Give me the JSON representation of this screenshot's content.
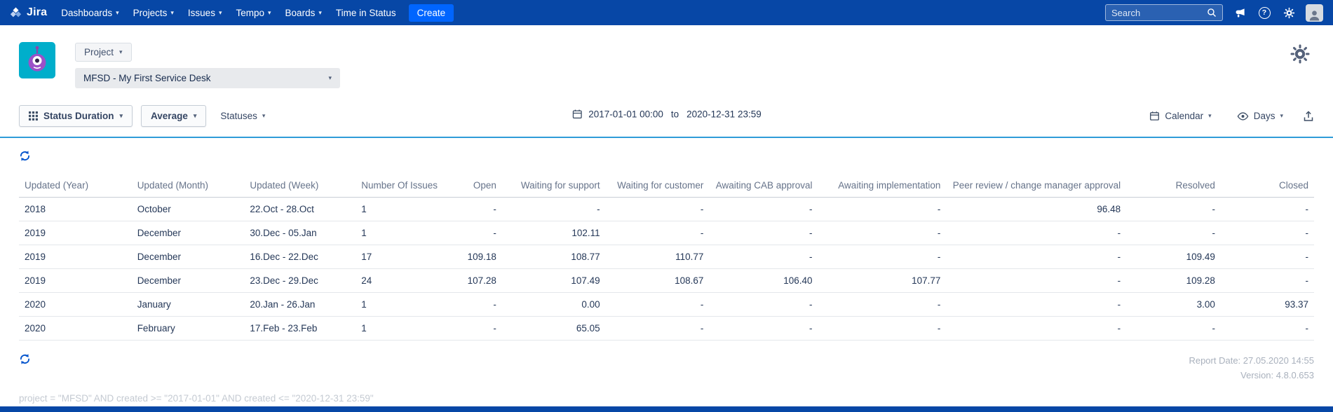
{
  "icons": {
    "chevron_down": "▾",
    "question_mark": "?"
  },
  "colors": {
    "header_blue": "#0747A6",
    "create_blue": "#0065FF",
    "accent_blue": "#0052CC",
    "divider_blue": "#2F9CD8"
  },
  "navbar": {
    "logo_text": "Jira",
    "items": [
      {
        "label": "Dashboards"
      },
      {
        "label": "Projects"
      },
      {
        "label": "Issues"
      },
      {
        "label": "Tempo"
      },
      {
        "label": "Boards"
      },
      {
        "label": "Time in Status"
      }
    ],
    "create_label": "Create",
    "search_placeholder": "Search"
  },
  "header": {
    "scope_label": "Project",
    "project": "MFSD - My First Service Desk"
  },
  "toolbar": {
    "report_type": "Status Duration",
    "aggregation": "Average",
    "statuses": "Statuses",
    "date_from": "2017-01-01 00:00",
    "date_separator": "to",
    "date_to": "2020-12-31 23:59",
    "calendar": "Calendar",
    "unit": "Days"
  },
  "table": {
    "columns": [
      "Updated (Year)",
      "Updated (Month)",
      "Updated (Week)",
      "Number Of Issues",
      "Open",
      "Waiting for support",
      "Waiting for customer",
      "Awaiting CAB approval",
      "Awaiting implementation",
      "Peer review / change manager approval",
      "Resolved",
      "Closed"
    ],
    "rows": [
      [
        "2018",
        "October",
        "22.Oct - 28.Oct",
        "1",
        "-",
        "-",
        "-",
        "-",
        "-",
        "96.48",
        "-",
        "-"
      ],
      [
        "2019",
        "December",
        "30.Dec - 05.Jan",
        "1",
        "-",
        "102.11",
        "-",
        "-",
        "-",
        "-",
        "-",
        "-"
      ],
      [
        "2019",
        "December",
        "16.Dec - 22.Dec",
        "17",
        "109.18",
        "108.77",
        "110.77",
        "-",
        "-",
        "-",
        "109.49",
        "-"
      ],
      [
        "2019",
        "December",
        "23.Dec - 29.Dec",
        "24",
        "107.28",
        "107.49",
        "108.67",
        "106.40",
        "107.77",
        "-",
        "109.28",
        "-"
      ],
      [
        "2020",
        "January",
        "20.Jan - 26.Jan",
        "1",
        "-",
        "0.00",
        "-",
        "-",
        "-",
        "-",
        "3.00",
        "93.37"
      ],
      [
        "2020",
        "February",
        "17.Feb - 23.Feb",
        "1",
        "-",
        "65.05",
        "-",
        "-",
        "-",
        "-",
        "-",
        "-"
      ]
    ]
  },
  "footer": {
    "report_date_label": "Report Date:",
    "report_date": "27.05.2020 14:55",
    "version_label": "Version:",
    "version": "4.8.0.653",
    "jql": "project = \"MFSD\" AND created >= \"2017-01-01\" AND created <= \"2020-12-31 23:59\""
  }
}
